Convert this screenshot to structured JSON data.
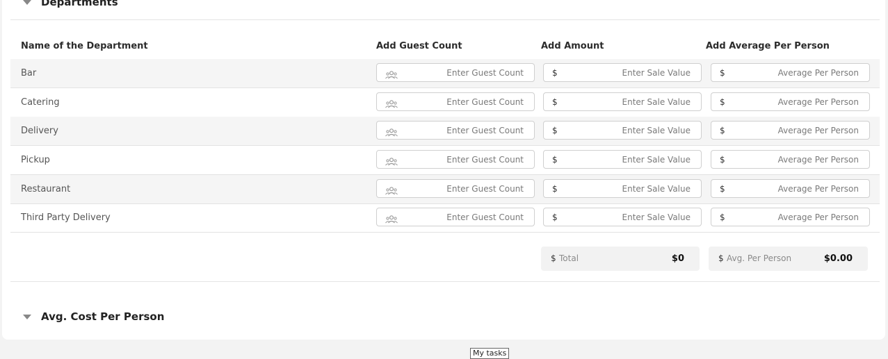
{
  "sections": {
    "departments_title": "Departments",
    "avg_cost_title": "Avg. Cost Per Person"
  },
  "columns": {
    "name": "Name of the Department",
    "guest": "Add Guest Count",
    "amount": "Add Amount",
    "avg": "Add Average Per Person"
  },
  "placeholders": {
    "guest": "Enter Guest Count",
    "sale": "Enter Sale Value",
    "avg": "Average Per Person"
  },
  "currency": "$",
  "rows": [
    {
      "label": "Bar"
    },
    {
      "label": "Catering"
    },
    {
      "label": "Delivery"
    },
    {
      "label": "Pickup"
    },
    {
      "label": "Restaurant"
    },
    {
      "label": "Third Party Delivery"
    }
  ],
  "totals": {
    "total_label": "Total",
    "total_value": "$0",
    "avg_label": "Avg. Per Person",
    "avg_value": "$0.00"
  },
  "tooltip": "My tasks",
  "icons": {
    "guest": "people-icon",
    "section": "caret-down-icon"
  }
}
